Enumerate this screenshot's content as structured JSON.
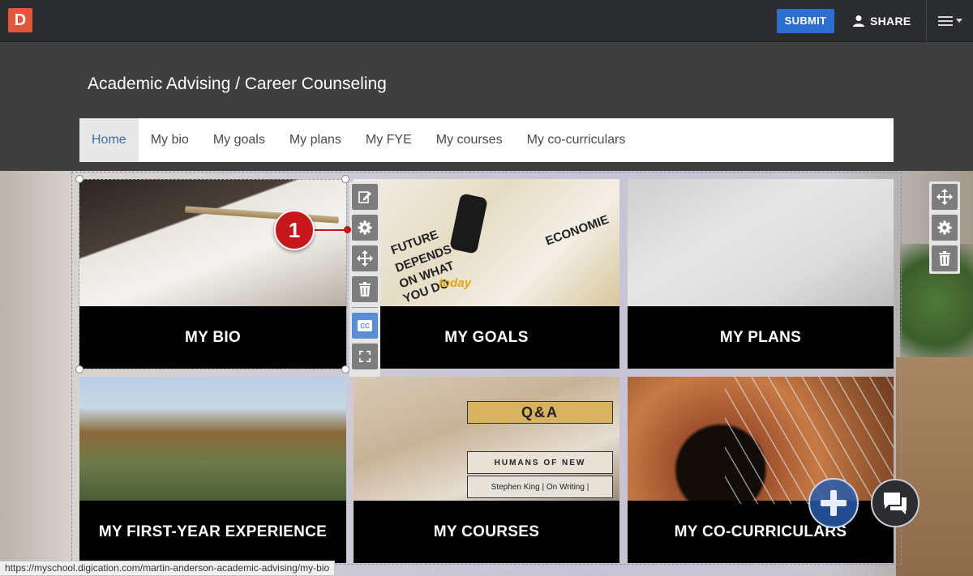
{
  "topbar": {
    "logo_letter": "D",
    "submit_label": "SUBMIT",
    "share_label": "SHARE"
  },
  "site": {
    "title": "Academic Advising / Career Counseling"
  },
  "nav": {
    "items": [
      {
        "label": "Home",
        "active": true
      },
      {
        "label": "My bio"
      },
      {
        "label": "My goals"
      },
      {
        "label": "My plans"
      },
      {
        "label": "My FYE"
      },
      {
        "label": "My courses"
      },
      {
        "label": "My co-curriculars"
      }
    ]
  },
  "tiles": [
    {
      "caption": "MY BIO",
      "image": "notebook-with-pencil"
    },
    {
      "caption": "MY GOALS",
      "image": "doodled-notebook-with-marker",
      "doodles": [
        "FUTURE",
        "DEPENDS",
        "ON WHAT",
        "YOU DO",
        "ECONOMIE",
        "today"
      ]
    },
    {
      "caption": "MY PLANS",
      "image": "open-planner-calendar"
    },
    {
      "caption": "MY FIRST-YEAR EXPERIENCE",
      "image": "college-bridge-over-river"
    },
    {
      "caption": "MY COURSES",
      "image": "stack-of-books",
      "book_spines": [
        "Q&A",
        "HUMANS OF NEW",
        "Stephen King | On Writing |"
      ]
    },
    {
      "caption": "MY CO-CURRICULARS",
      "image": "acoustic-guitar"
    }
  ],
  "callout": {
    "number": "1"
  },
  "block_toolbar": {
    "buttons": [
      "edit-icon",
      "gear-icon",
      "move-icon",
      "trash-icon",
      "closed-caption-icon",
      "fullscreen-icon"
    ]
  },
  "section_toolbar": {
    "buttons": [
      "move-icon",
      "gear-icon",
      "trash-icon"
    ]
  },
  "status_url": "https://myschool.digication.com/martin-anderson-academic-advising/my-bio",
  "colors": {
    "topbar": "#2b2c2f",
    "logo": "#e0573a",
    "submit": "#2d6fd1",
    "callout": "#c8161d",
    "active_nav_text": "#3a6ea5"
  }
}
